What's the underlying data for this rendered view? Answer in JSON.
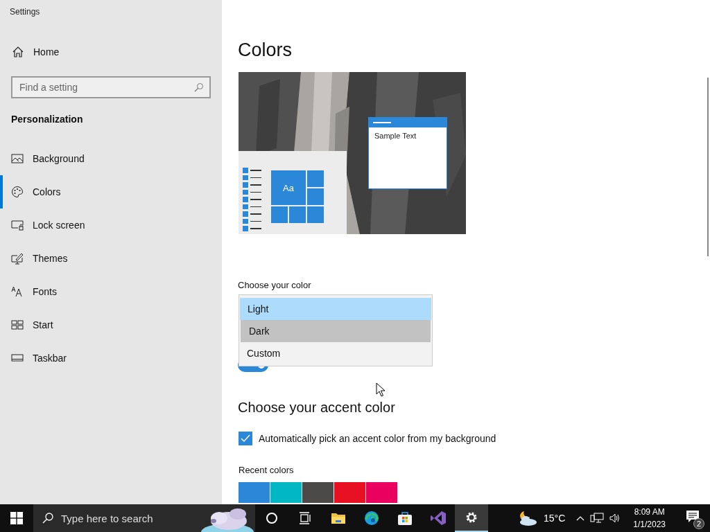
{
  "window": {
    "title": "Settings"
  },
  "sidebar": {
    "home": "Home",
    "search": {
      "placeholder": "Find a setting"
    },
    "section": "Personalization",
    "items": [
      {
        "kind": "background",
        "label": "Background",
        "selected": false
      },
      {
        "kind": "colors",
        "label": "Colors",
        "selected": true
      },
      {
        "kind": "lockscreen",
        "label": "Lock screen",
        "selected": false
      },
      {
        "kind": "themes",
        "label": "Themes",
        "selected": false
      },
      {
        "kind": "fonts",
        "label": "Fonts",
        "selected": false
      },
      {
        "kind": "start",
        "label": "Start",
        "selected": false
      },
      {
        "kind": "taskbar",
        "label": "Taskbar",
        "selected": false
      }
    ]
  },
  "main": {
    "title": "Colors",
    "preview": {
      "tile_label": "Aa",
      "sample_text": "Sample Text"
    },
    "color_mode": {
      "label": "Choose your color",
      "options": [
        {
          "label": "Light",
          "selected": true,
          "hovered": false
        },
        {
          "label": "Dark",
          "selected": false,
          "hovered": true
        },
        {
          "label": "Custom",
          "selected": false,
          "hovered": false
        }
      ],
      "toggle": {
        "on": true
      }
    },
    "accent": {
      "heading": "Choose your accent color",
      "auto_pick": {
        "label": "Automatically pick an accent color from my background",
        "checked": true
      },
      "recent_label": "Recent colors",
      "recent_colors": [
        {
          "color": "#2b88d8"
        },
        {
          "color": "#00b7c3"
        },
        {
          "color": "#4c4a48"
        },
        {
          "color": "#e81123"
        },
        {
          "color": "#ea005e"
        }
      ]
    }
  },
  "taskbar": {
    "search_placeholder": "Type here to search",
    "apps": [
      {
        "kind": "cortana",
        "active": false
      },
      {
        "kind": "taskview",
        "active": false
      },
      {
        "kind": "explorer",
        "active": false
      },
      {
        "kind": "edge",
        "active": false
      },
      {
        "kind": "store",
        "active": false
      },
      {
        "kind": "studio",
        "active": false
      },
      {
        "kind": "settings",
        "active": true
      }
    ],
    "temperature": "15°C",
    "time": "8:09 AM",
    "date": "1/1/2023",
    "notification_count": "2"
  }
}
